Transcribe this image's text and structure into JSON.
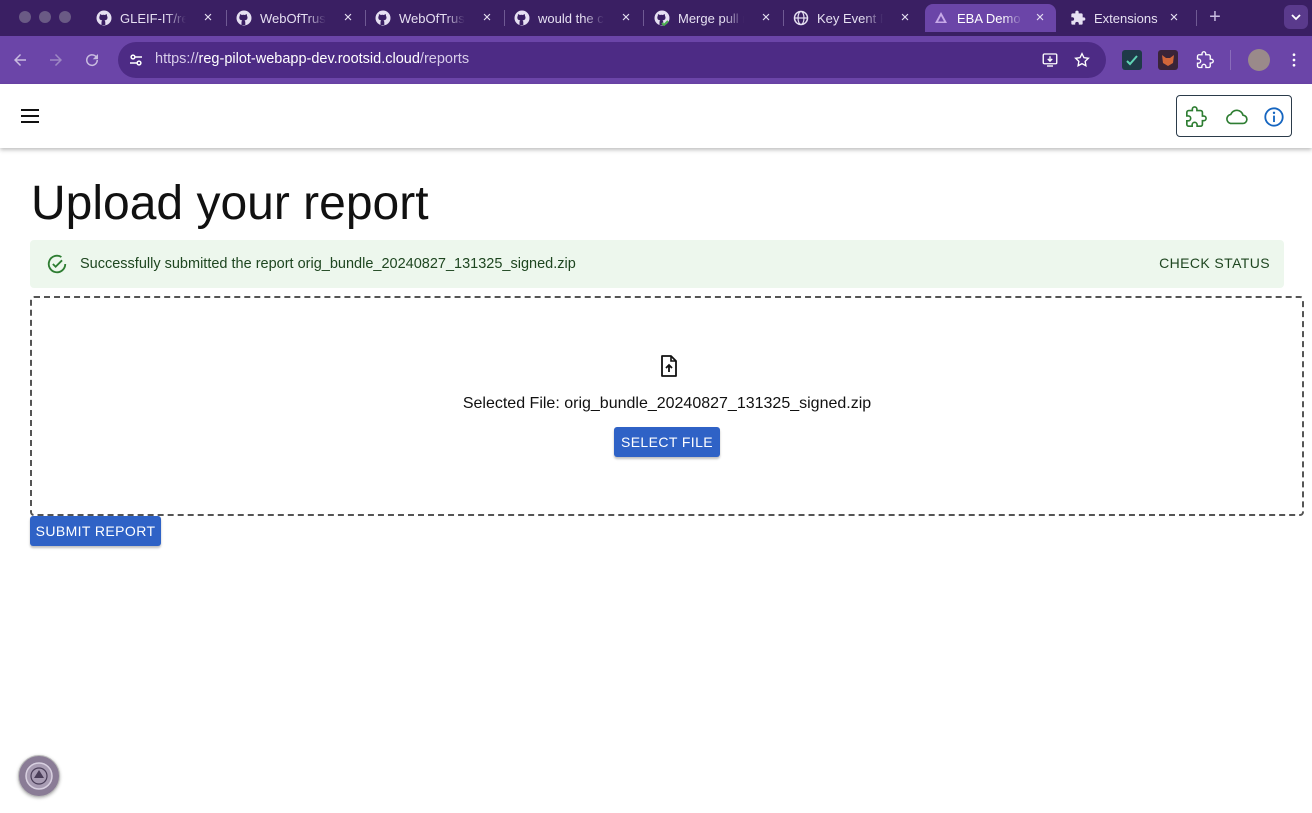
{
  "browser": {
    "tabs": [
      {
        "title": "GLEIF-IT/reg",
        "icon": "github-icon"
      },
      {
        "title": "WebOfTrust",
        "icon": "github-icon"
      },
      {
        "title": "WebOfTrust",
        "icon": "github-icon"
      },
      {
        "title": "would the c",
        "icon": "github-icon"
      },
      {
        "title": "Merge pull r",
        "icon": "github-check-icon"
      },
      {
        "title": "Key Event R",
        "icon": "globe-icon"
      },
      {
        "title": "EBA Demo",
        "icon": "app-logo-icon",
        "active": true
      },
      {
        "title": "Extensions",
        "icon": "puzzle-icon"
      }
    ],
    "close_glyph": "×",
    "new_tab_glyph": "+",
    "url_scheme": "https://",
    "url_host": "reg-pilot-webapp-dev.rootsid.cloud",
    "url_path": "/reports"
  },
  "page": {
    "title": "Upload your report",
    "alert": {
      "message": "Successfully submitted the report orig_bundle_20240827_131325_signed.zip",
      "action_label": "CHECK STATUS",
      "color": "#edf7ed"
    },
    "dropzone": {
      "selected_file_text": "Selected File: orig_bundle_20240827_131325_signed.zip",
      "select_button_label": "SELECT FILE"
    },
    "submit_button_label": "SUBMIT REPORT"
  },
  "colors": {
    "tabstrip": "#3a1f63",
    "toolbar": "#6b45a8",
    "primary_button": "#2f62c6",
    "success_green": "#2e7d32"
  }
}
